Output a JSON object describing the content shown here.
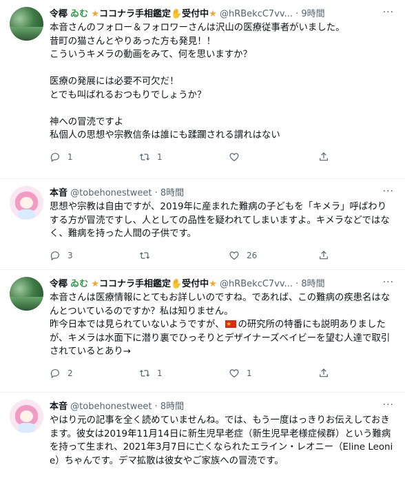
{
  "tweets": [
    {
      "name": "令椰",
      "badge": "ゐむ",
      "tag1": "★",
      "tag1_text": "ココナラ手相鑑定",
      "tag2": "✋",
      "tag2_text": "受付中",
      "tag3": "★",
      "handle": "@hRBekcC7vv...",
      "time": "9時間",
      "body": "本音さんのフォロー＆フォロワーさんは沢山の医療従事者がいました。\n昔町の猫さんとやりあった方も発見！！\nこういうキメラの動画をみて、何を思いますか？\n\n医療の発展には必要不可欠だ！\nとでも叫ばれるおつもりでしょうか？\n\n神への冒涜ですよ\n私個人の思想や宗教信条は誰にも蹂躙される謂れはない",
      "replies": "1",
      "retweets": "1",
      "likes": ""
    },
    {
      "name": "本音",
      "handle": "@tobehonestweet",
      "time": "8時間",
      "body": "思想や宗教は自由ですが、2019年に産まれた難病の子どもを「キメラ」呼ばわりする方が冒涜ですし、人としての品性を疑われてしまいますよ。キメラなどではなく、難病を持った人間の子供です。",
      "replies": "3",
      "retweets": "",
      "likes": "26"
    },
    {
      "name": "令椰",
      "badge": "ゐむ",
      "tag1": "★",
      "tag1_text": "ココナラ手相鑑定",
      "tag2": "✋",
      "tag2_text": "受付中",
      "tag3": "★",
      "handle": "@hRBekcC7vv...",
      "time": "8時間",
      "body_a": "本音さんは医療情報にとてもお詳しいのですね。であれば、この難病の疾患名はなんとついているのですか？私は知りません。\n昨今日本では見られていないようですが、",
      "body_b": "の研究所の特番にも説明ありましたが、キメラは水面下に潜り裏でひっそりとデザイナーズベイビーを望む人達で取引されているとあり→",
      "replies": "2",
      "retweets": "1",
      "likes": "1"
    },
    {
      "name": "本音",
      "handle": "@tobehonestweet",
      "time": "8時間",
      "body": "やはり元の記事を全く読めていませんね。では、もう一度はっきりお伝えしておきます。彼女は2019年11月14日に新生児早老症（新生児早老様症候群）という難病を持って生まれ、2021年3月7日に亡くなられたエライン・レオニー（Eline Leonie）ちゃんです。デマ拡散は彼女やご家族への冒涜です。",
      "replies": "",
      "retweets": "",
      "likes": ""
    }
  ]
}
